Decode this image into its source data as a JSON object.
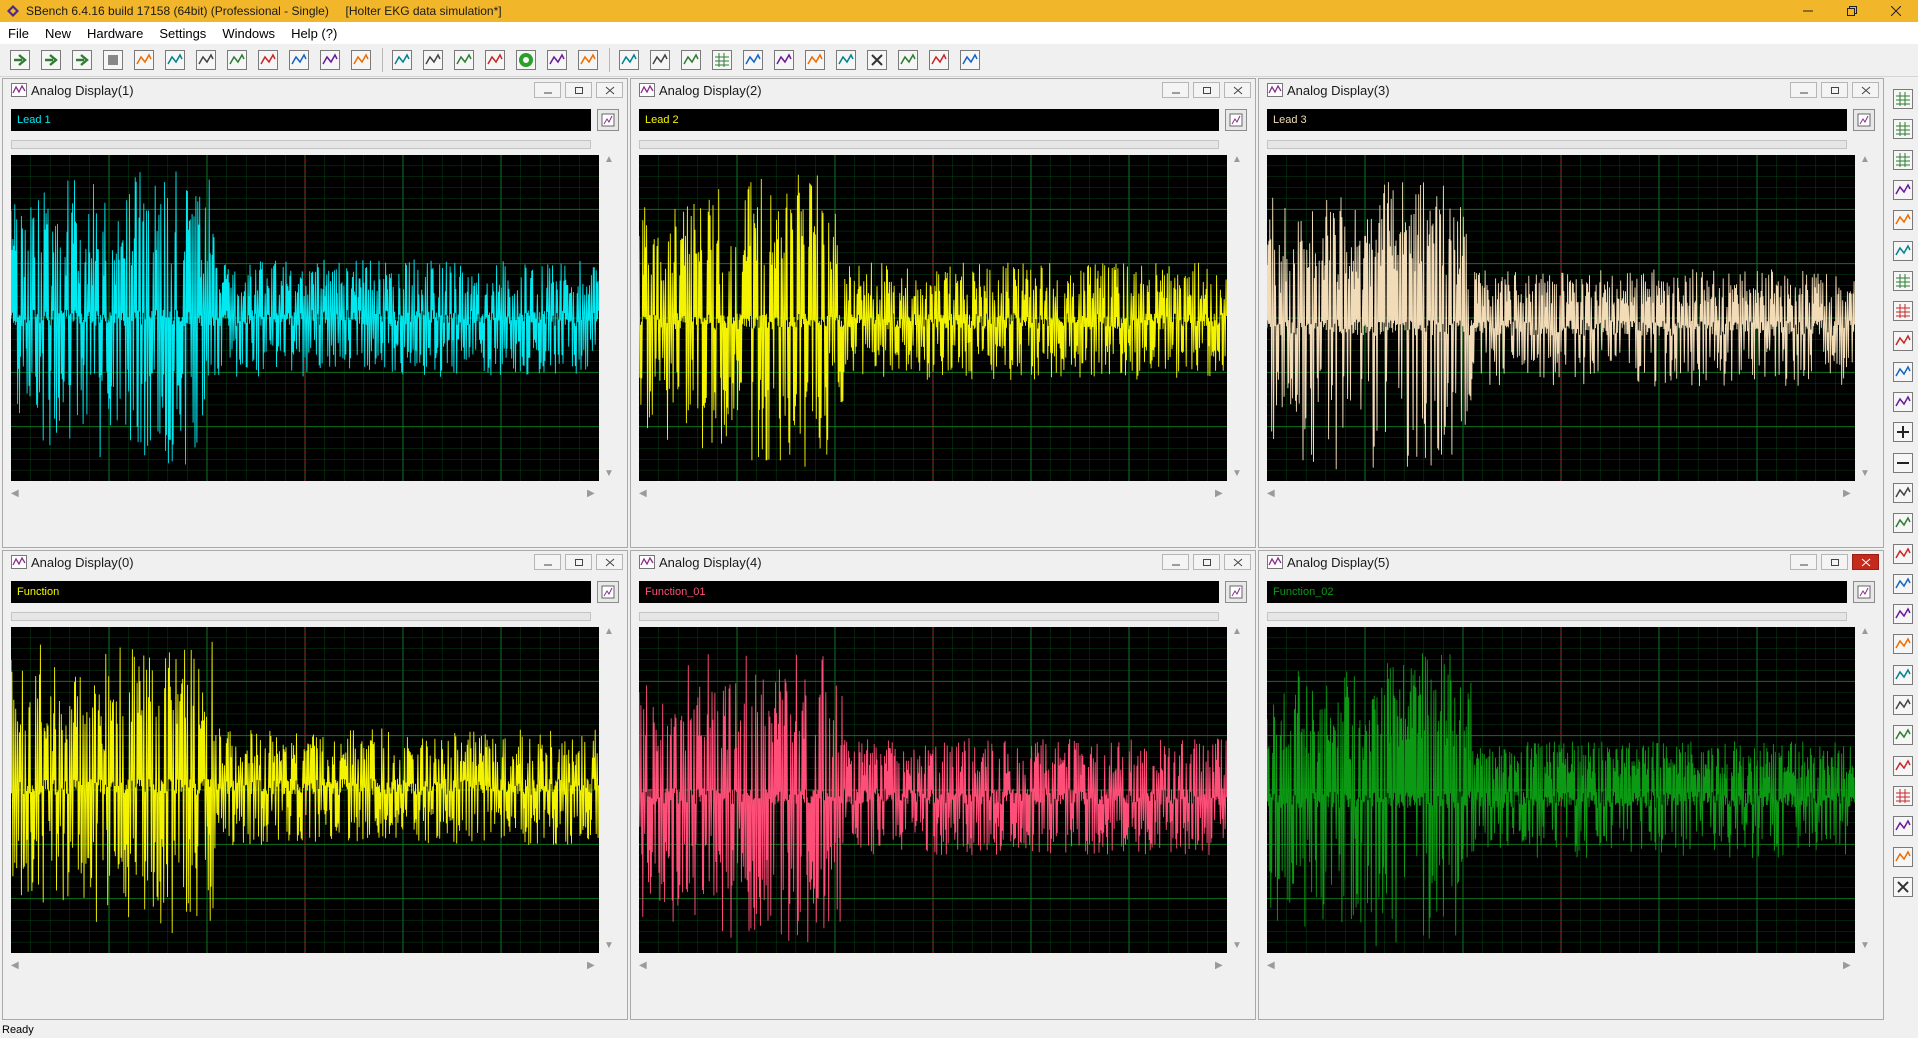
{
  "window": {
    "title": "SBench 6.4.16 build 17158 (64bit) (Professional - Single)     [Holter EKG data simulation*]"
  },
  "menu": [
    "File",
    "New",
    "Hardware",
    "Settings",
    "Windows",
    "Help (?)"
  ],
  "toolbar": {
    "icons": [
      "start-icon",
      "start-acquisition-icon",
      "continuous-icon",
      "stop-icon",
      "force-trigger-icon",
      "calc-amplitude-icon",
      "calc-info-icon",
      "calc-fft-icon",
      "calc-histogram-icon",
      "calc-math-icon",
      "calc-average-icon",
      "calc-filter-icon",
      "new-analog-display-icon",
      "new-text-display-icon",
      "export-icon",
      "save-icon",
      "settings-gear-icon",
      "window-icon",
      "list-icon",
      "analog-view-icon",
      "xy-view-icon",
      "fft-view-icon",
      "grid-view-icon",
      "pen-icon",
      "signal-icon",
      "tile-icon",
      "arrange-icon",
      "close-all-icon",
      "split-horizontal-icon",
      "split-vertical-icon",
      "full-screen-icon"
    ]
  },
  "right_toolbar": {
    "icons": [
      "grid-green-icon",
      "hex-view-icon",
      "table-view-icon",
      "book-icon",
      "link-icon",
      "red-curve-icon",
      "gray-grid-icon",
      "colored-grid-icon",
      "overlay-icon",
      "copy-display-icon",
      "fit-width-icon",
      "zoom-in-icon",
      "zoom-out-icon",
      "fit-all-icon",
      "fit-x-icon",
      "fit-y-icon",
      "expand-x-icon",
      "expand-y-icon",
      "shrink-x-icon",
      "shrink-y-icon",
      "scale-up-icon",
      "scale-down-icon",
      "smooth-icon",
      "grid-red-icon",
      "undo-zoom-icon",
      "redo-zoom-icon",
      "reset-zoom-icon"
    ]
  },
  "panels": [
    {
      "title": "Analog Display(1)",
      "channel": "Lead 1",
      "color": "#00e8f0"
    },
    {
      "title": "Analog Display(2)",
      "channel": "Lead 2",
      "color": "#f4f400"
    },
    {
      "title": "Analog Display(3)",
      "channel": "Lead 3",
      "color": "#f2dcb8"
    },
    {
      "title": "Analog Display(0)",
      "channel": "Function",
      "color": "#f4f400"
    },
    {
      "title": "Analog Display(4)",
      "channel": "Function_01",
      "color": "#ff4f78"
    },
    {
      "title": "Analog Display(5)",
      "channel": "Function_02",
      "color": "#0c9a14"
    }
  ],
  "colors": {
    "titlebar": "#f2b62a",
    "grid": "#0c7a20",
    "trigger_marker": "#c0182c",
    "plot_background": "#000000"
  },
  "status": "Ready"
}
